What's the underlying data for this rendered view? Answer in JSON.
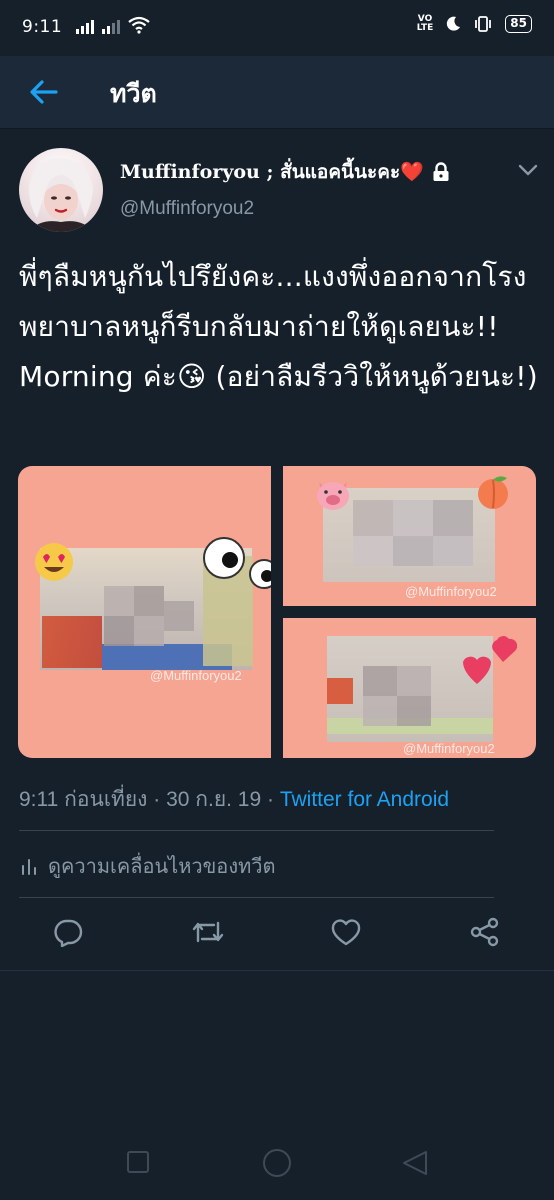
{
  "status_bar": {
    "time": "9:11",
    "network_label": "VoLTE",
    "battery": "85"
  },
  "header": {
    "title": "ทวีต"
  },
  "tweet": {
    "display_name": "Muffinforyou ; สั่นแอคนี้นะคะ❤️",
    "handle": "@Muffinforyou2",
    "text": "พี่ๆลืมหนูกันไปรึยังคะ...แงงพึ่งออกจากโรงพยาบาลหนูก็รีบกลับมาถ่ายให้ดูเลยนะ!! Morning ค่ะ😘 (อย่าลืมรีววิให้หนูด้วยนะ!)",
    "watermark": "@Muffinforyou2",
    "timestamp": "9:11 ก่อนเที่ยง · 30 ก.ย. 19 · ",
    "source": "Twitter for Android",
    "activity_label": "ดูความเคลื่อนไหวของทวีต"
  },
  "icons": {
    "back": "arrow-left-icon",
    "lock": "lock-icon",
    "caret": "chevron-down-icon",
    "reply": "reply-icon",
    "retweet": "retweet-icon",
    "like": "heart-icon",
    "share": "share-icon",
    "activity": "bar-chart-icon"
  },
  "colors": {
    "background": "#15202b",
    "header": "#1c2938",
    "accent": "#1da1f2",
    "secondary_text": "#8899a6",
    "media_border": "#f6a592"
  }
}
